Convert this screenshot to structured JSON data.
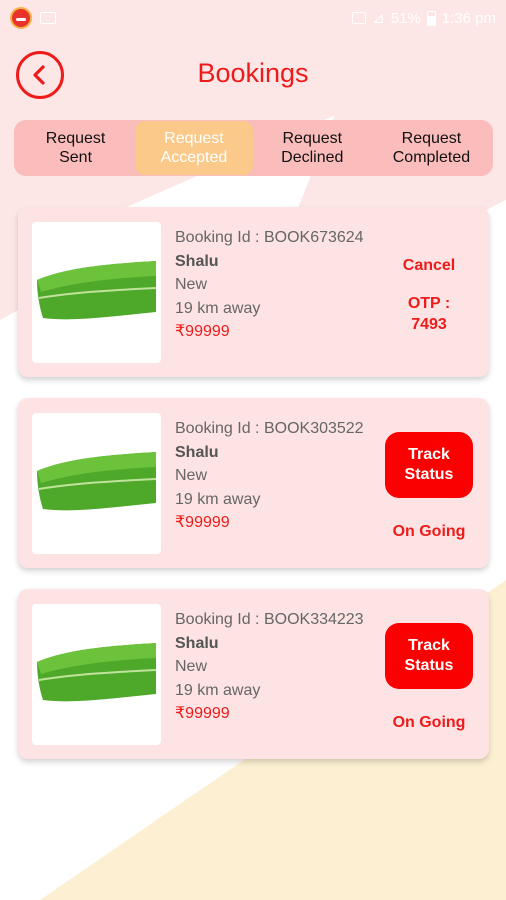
{
  "status_bar": {
    "signal_text": "⊿",
    "battery_percent": "51%",
    "time": "1:36 pm"
  },
  "header": {
    "title": "Bookings"
  },
  "tabs": [
    {
      "line1": "Request",
      "line2": "Sent",
      "active": false
    },
    {
      "line1": "Request",
      "line2": "Accepted",
      "active": true
    },
    {
      "line1": "Request",
      "line2": "Declined",
      "active": false
    },
    {
      "line1": "Request",
      "line2": "Completed",
      "active": false
    }
  ],
  "labels": {
    "booking_id": "Booking Id :",
    "cancel": "Cancel",
    "otp_label": "OTP :",
    "track_line1": "Track",
    "track_line2": "Status",
    "on_going": "On Going"
  },
  "bookings": [
    {
      "id": "BOOK673624",
      "name": "Shalu",
      "status": "New",
      "distance": "19 km away",
      "price": "₹99999",
      "otp": "7493"
    },
    {
      "id": "BOOK303522",
      "name": "Shalu",
      "status": "New",
      "distance": "19 km away",
      "price": "₹99999"
    },
    {
      "id": "BOOK334223",
      "name": "Shalu",
      "status": "New",
      "distance": "19 km away",
      "price": "₹99999"
    }
  ],
  "colors": {
    "accent": "#ee1b1b",
    "tab_bar": "#fbbcbc",
    "tab_active": "#fbc98a",
    "card_bg": "#fde3e3",
    "bg_pink": "#fde6e6",
    "bg_cream": "#fdf0d2"
  }
}
